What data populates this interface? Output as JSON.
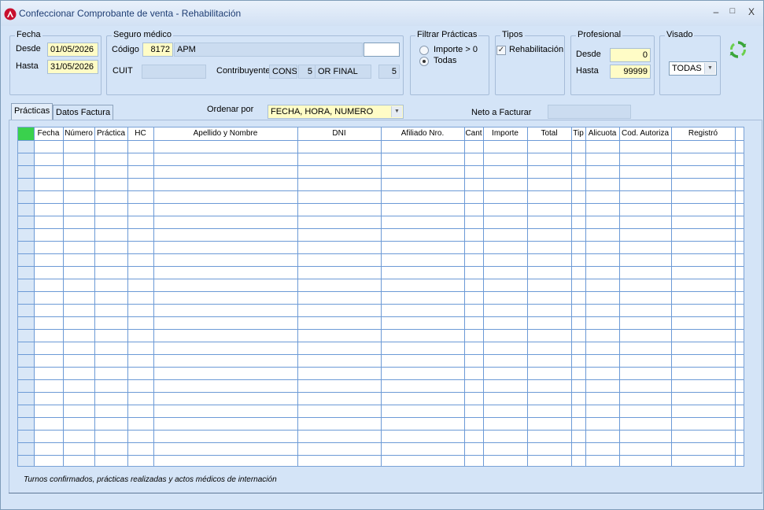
{
  "window": {
    "title": "Confeccionar Comprobante de venta - Rehabilitación",
    "minimize": "–",
    "maximize": "□",
    "close": "X"
  },
  "fecha": {
    "title": "Fecha",
    "desde_label": "Desde",
    "desde_value": "01/05/2026",
    "hasta_label": "Hasta",
    "hasta_value": "31/05/2026"
  },
  "seguro": {
    "title": "Seguro médico",
    "codigo_label": "Código",
    "codigo_value": "8172",
    "nombre_value": "APM",
    "extra_value": "",
    "cuit_label": "CUIT",
    "cuit_value": "",
    "contribuyente_label": "Contribuyente",
    "contribuyente_a": "CONSU",
    "contribuyente_b": "5",
    "contribuyente_c": "OR FINAL",
    "contribuyente_d": "5"
  },
  "filtrar": {
    "title": "Filtrar Prácticas",
    "option1": "Importe > 0",
    "option2": "Todas",
    "selected": "Todas"
  },
  "tipos": {
    "title": "Tipos",
    "rehab_label": "Rehabilitación",
    "rehab_checked": true
  },
  "profesional": {
    "title": "Profesional",
    "desde_label": "Desde",
    "desde_value": "0",
    "hasta_label": "Hasta",
    "hasta_value": "99999"
  },
  "visado": {
    "title": "Visado",
    "value": "TODAS"
  },
  "tabs": [
    {
      "label": "Prácticas",
      "active": true
    },
    {
      "label": "Datos Factura",
      "active": false
    }
  ],
  "ordenar": {
    "label": "Ordenar por",
    "value": "FECHA, HORA, NUMERO"
  },
  "neto": {
    "label": "Neto a Facturar",
    "value": ""
  },
  "grid": {
    "columns": [
      "Fecha",
      "Número",
      "Práctica",
      "HC",
      "Apellido y Nombre",
      "DNI",
      "Afiliado Nro.",
      "Cant",
      "Importe",
      "Total",
      "Tip",
      "Alicuota",
      "Cod. Autoriza",
      "Registró"
    ],
    "row_count": 26
  },
  "footer": {
    "note": "Turnos confirmados, prácticas realizadas y actos médicos de internación"
  },
  "colors": {
    "accent": "#3ad14d",
    "field_yellow": "#fffcc6",
    "background": "#d4e4f7",
    "grid_line": "#6c9ad6"
  }
}
